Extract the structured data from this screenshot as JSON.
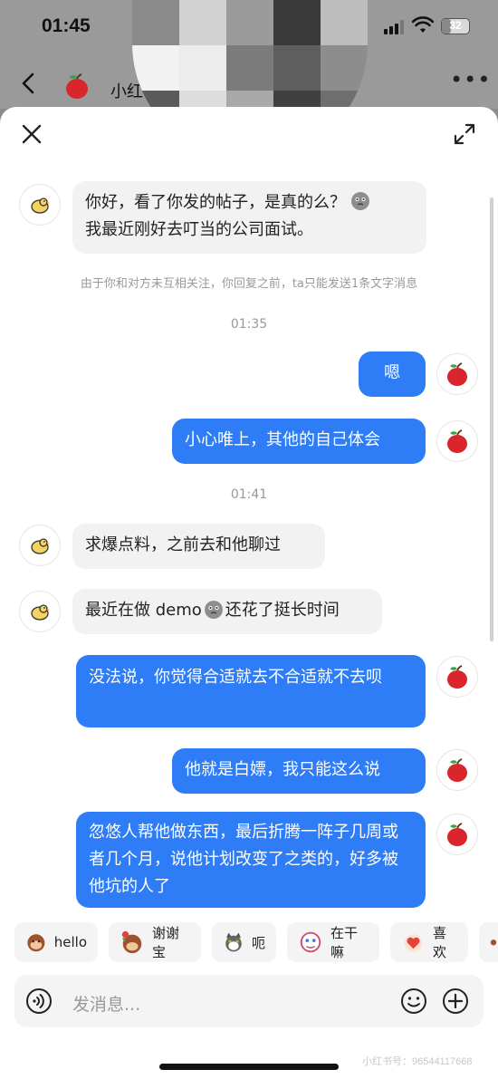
{
  "status_bar": {
    "time": "01:45",
    "battery": "32",
    "battery_fraction": 0.32
  },
  "header": {
    "name": "小红"
  },
  "notice": "由于你和对方未互相关注，你回复之前，ta只能发送1条文字消息",
  "messages": [
    {
      "side": "in",
      "text": "你好，看了你发的帖子，是真的么？"
    },
    {
      "side": "in",
      "text": "我最近刚好去叮当的公司面试。"
    },
    {
      "side": "out",
      "text": "嗯"
    },
    {
      "side": "out",
      "text": "小心唯上，其他的自己体会"
    },
    {
      "side": "in",
      "text": "求爆点料，之前去和他聊过"
    },
    {
      "side": "in",
      "text": "最近在做 demo"
    },
    {
      "side": "in",
      "text": "还花了挺长时间"
    },
    {
      "side": "out",
      "text": "没法说，你觉得合适就去不合适就不去呗"
    },
    {
      "side": "out",
      "text": "他就是白嫖，我只能这么说"
    },
    {
      "side": "out",
      "text": "忽悠人帮他做东西，最后折腾一阵子几周或者几个月，说他计划改变了之类的，好多被他坑的人了"
    }
  ],
  "timestamps": [
    "01:35",
    "01:41"
  ],
  "quick_replies": [
    "hello",
    "谢谢宝",
    "呃",
    "在干嘛",
    "喜欢"
  ],
  "input": {
    "placeholder": "发消息..."
  },
  "watermark": "小红书号：96544117668",
  "colors": {
    "outgoing_bubble": "#2e7cf6",
    "incoming_bubble": "#f2f2f2"
  }
}
